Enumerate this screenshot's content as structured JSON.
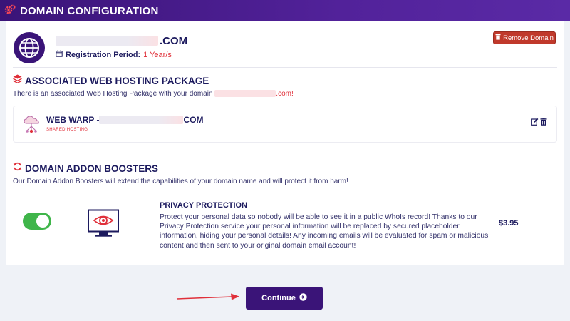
{
  "header": {
    "title": "DOMAIN CONFIGURATION",
    "icon": "cogs-icon"
  },
  "domain": {
    "suffix": ".COM",
    "registration_label": "Registration Period:",
    "registration_value": "1 Year/s",
    "remove_label": "Remove Domain"
  },
  "hosting": {
    "title": "ASSOCIATED WEB HOSTING PACKAGE",
    "desc_prefix": "There is an associated Web Hosting Package with your domain ",
    "desc_suffix": ".com!",
    "package_name": "WEB WARP - ",
    "package_suffix": "COM",
    "package_type": "SHARED HOSTING"
  },
  "boosters": {
    "title": "DOMAIN ADDON BOOSTERS",
    "desc": "Our Domain Addon Boosters will extend the capabilities of your domain name and will protect it from harm!",
    "items": [
      {
        "name": "PRIVACY PROTECTION",
        "description": "Protect your personal data so nobody will be able to see it in a public WhoIs record! Thanks to our Privacy Protection service your personal information will be replaced by secured placeholder information, hiding your personal details! Any incoming emails will be evaluated for spam or malicious content and then sent to your original domain email account!",
        "price": "$3.95",
        "enabled": true
      }
    ]
  },
  "actions": {
    "continue_label": "Continue"
  },
  "colors": {
    "brand": "#3a1478",
    "accent": "#e0303a",
    "toggle_on": "#3fb54a",
    "danger": "#c0392b"
  }
}
